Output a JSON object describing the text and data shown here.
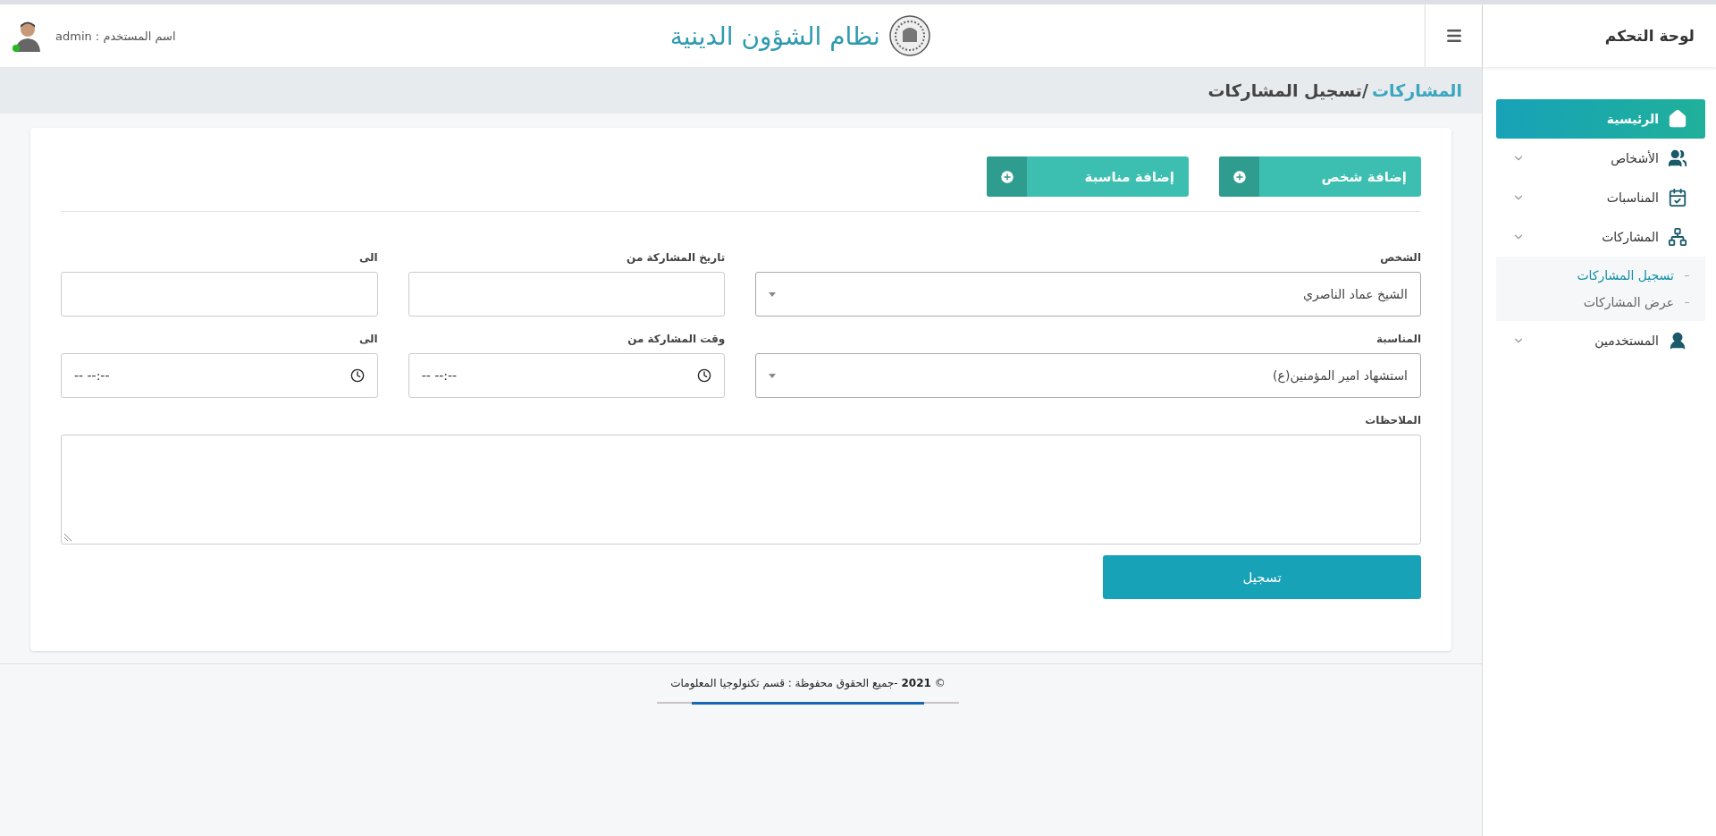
{
  "header": {
    "title": "نظام الشؤون الدينية",
    "user_label": "اسم المستخدم : admin",
    "online": true
  },
  "sidebar": {
    "title": "لوحة التحكم",
    "items": [
      {
        "label": "الرئيسية",
        "kind": "link",
        "selected": true
      },
      {
        "label": "الأشخاص",
        "kind": "menu",
        "selected": false
      },
      {
        "label": "المناسبات",
        "kind": "menu",
        "selected": false
      },
      {
        "label": "المشاركات",
        "kind": "menu",
        "selected": false,
        "children": [
          {
            "label": "تسجيل المشاركات",
            "selected": true
          },
          {
            "label": "عرض المشاركات",
            "selected": false
          }
        ]
      },
      {
        "label": "المستخدمين",
        "kind": "menu",
        "selected": false
      }
    ]
  },
  "breadcrumb": {
    "parent": "المشاركات",
    "current": "/تسجيل المشاركات"
  },
  "actions": [
    {
      "label": "إضافة شخص"
    },
    {
      "label": "إضافة مناسبة"
    }
  ],
  "fields": [
    {
      "kind": "select",
      "label": "الشخص",
      "value": "الشيخ عماد الناصري"
    },
    {
      "kind": "date",
      "label": "تاريخ المشاركة من"
    },
    {
      "kind": "date",
      "label": "الى"
    },
    {
      "kind": "select",
      "label": "المناسبة",
      "value": "استشهاد امير المؤمنين(ع)"
    },
    {
      "kind": "time",
      "label": "وقت المشاركة من",
      "placeholder": "--:-- --"
    },
    {
      "kind": "time",
      "label": "الى",
      "placeholder": "--:-- --"
    },
    {
      "kind": "textarea",
      "label": "الملاحظات"
    }
  ],
  "submit": "تسجيل",
  "footer": "© **2021** -جميع الحقوق محفوظة : قسم تكنولوجيا المعلومات"
}
